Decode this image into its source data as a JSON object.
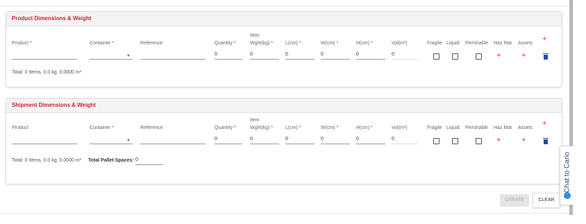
{
  "product_section": {
    "title": "Product Dimensions & Weight",
    "headers": {
      "product": "Product *",
      "container": "Container *",
      "reference": "Reference",
      "quantity": "Quantity *",
      "item_weight_line1": "Item",
      "item_weight_line2": "Wght(kg) *",
      "l": "L(cm) *",
      "w": "W(cm) *",
      "h": "H(cm) *",
      "vol": "Vol(m³)",
      "fragile": "Fragile",
      "liquid": "Liquid",
      "perishable": "Perishable",
      "hazmat": "Haz Mat",
      "assets": "Assets"
    },
    "row": {
      "quantity": "0",
      "item_weight": "0",
      "l": "0",
      "w": "0",
      "h": "0",
      "vol": "0"
    },
    "total": "Total: 0 Items, 0.0 kg, 0.0000 m³"
  },
  "shipment_section": {
    "title": "Shipment Dimensions & Weight",
    "headers": {
      "product": "Product",
      "container": "Container *",
      "reference": "Reference",
      "quantity": "Quantity *",
      "item_weight_line1": "Item",
      "item_weight_line2": "Wght(kg) *",
      "l": "L(cm) *",
      "w": "W(cm) *",
      "h": "H(cm) *",
      "vol": "Vol(m³)",
      "fragile": "Fragile",
      "liquid": "Liquid",
      "perishable": "Perishable",
      "hazmat": "Haz Mat",
      "assets": "Assets"
    },
    "row": {
      "quantity": "0",
      "item_weight": "0",
      "l": "0",
      "w": "0",
      "h": "0",
      "vol": "0"
    },
    "total": "Total: 0 Items, 0.0 kg, 0.0000 m³",
    "pallet_label": "Total Pallet Spaces:",
    "pallet_value": "0"
  },
  "actions": {
    "create": "CREATE",
    "clear": "CLEAR"
  },
  "chat": {
    "label": "Chat to Cario"
  },
  "icons": {
    "add": "plus-icon",
    "delete": "trash-icon",
    "dropdown": "caret-down-icon",
    "chat": "chat-bubble-icon"
  },
  "colors": {
    "accent_red": "#d0242b",
    "delete_blue": "#1e4ea8",
    "chat_blue": "#2f8ee5"
  }
}
